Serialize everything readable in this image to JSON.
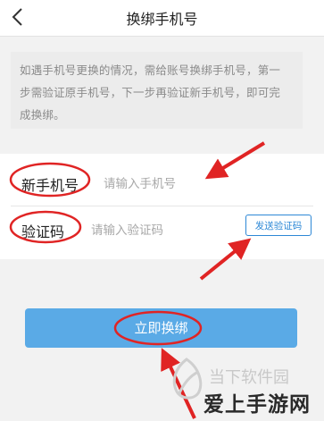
{
  "header": {
    "title": "换绑手机号"
  },
  "notice": {
    "lines": [
      "如遇手机号更换的情况，需给账号换绑手机号，第一",
      "步需验证原手机号，下一步再验证新手机号，即可完",
      "成换绑。"
    ]
  },
  "form": {
    "phone_label": "新手机号",
    "phone_placeholder": "请输入手机号",
    "code_label": "验证码",
    "code_placeholder": "请输入验证码",
    "send_code_label": "发送验证码"
  },
  "submit_label": "立即换绑",
  "watermark": {
    "line1": "当下软件园",
    "line2": "爱上手游网"
  },
  "colors": {
    "accent": "#2d88d6",
    "button": "#5aaae6",
    "annotation": "#e02424"
  }
}
